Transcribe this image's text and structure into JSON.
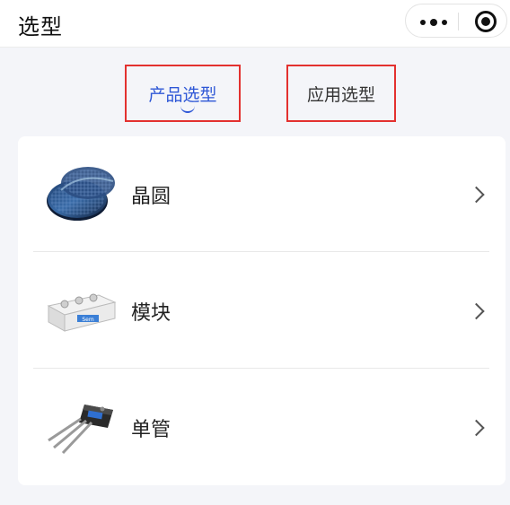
{
  "header": {
    "title": "选型",
    "menu_icon": "more-dots-icon",
    "close_icon": "target-circle-icon"
  },
  "tabs": [
    {
      "label": "产品选型",
      "active": true
    },
    {
      "label": "应用选型",
      "active": false
    }
  ],
  "colors": {
    "accent": "#2e57d6",
    "highlight_box": "#e3312f",
    "background": "#f4f5f9"
  },
  "list": {
    "items": [
      {
        "label": "晶圆",
        "icon": "wafer-icon"
      },
      {
        "label": "模块",
        "icon": "power-module-icon"
      },
      {
        "label": "单管",
        "icon": "transistor-icon"
      }
    ]
  }
}
